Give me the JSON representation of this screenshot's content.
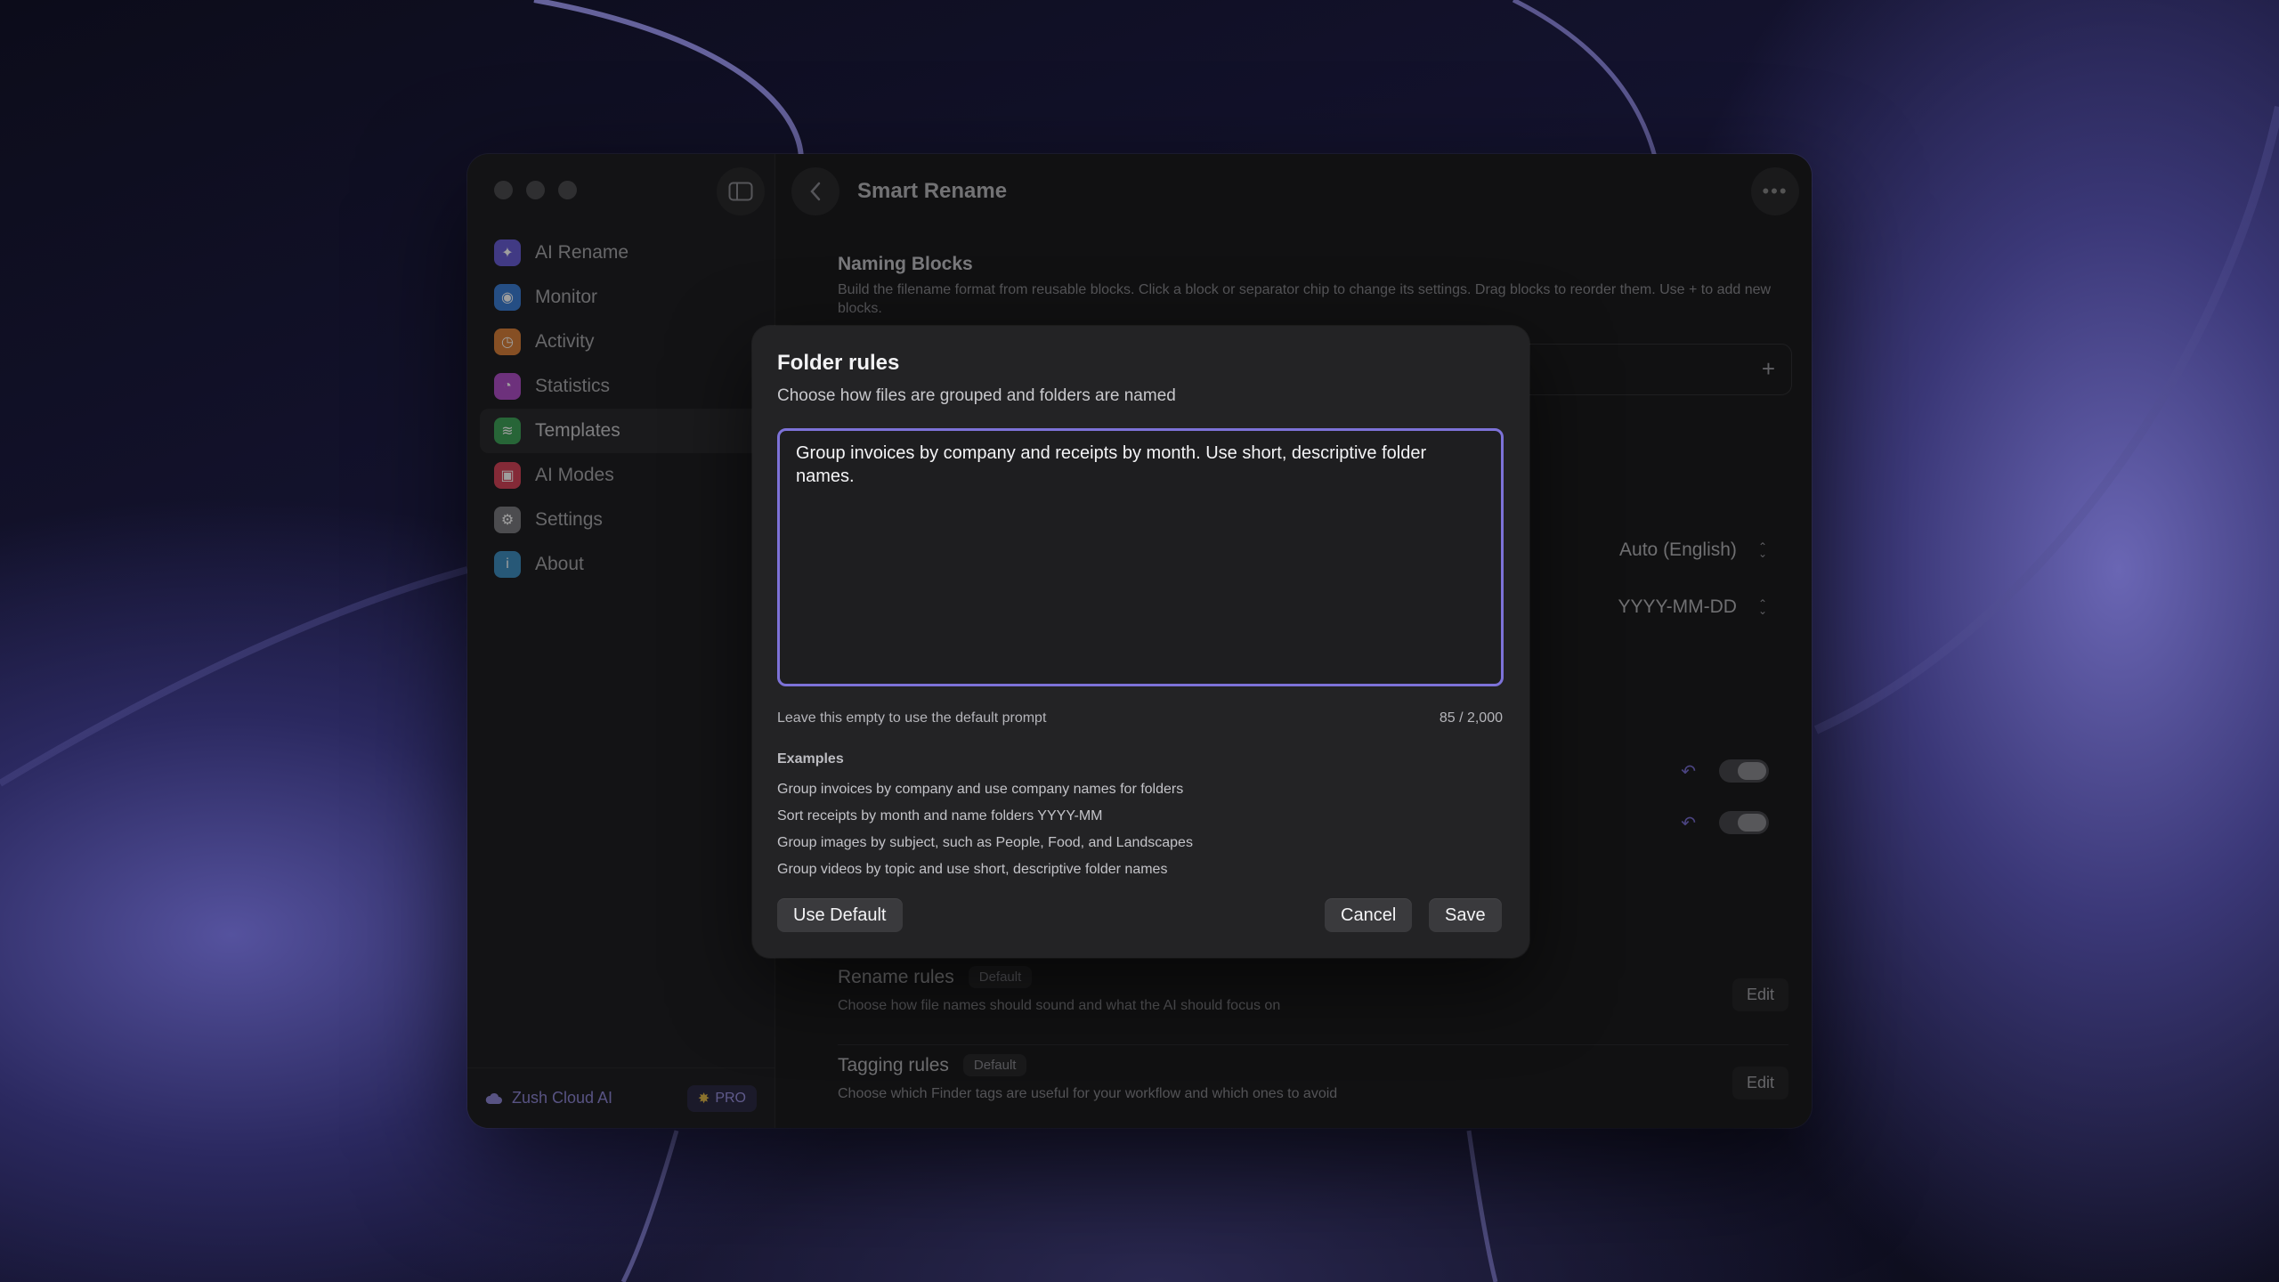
{
  "window": {
    "title": "Smart Rename"
  },
  "sidebar": {
    "items": [
      {
        "label": "AI Rename",
        "icon": "sparkles-icon",
        "color": "#6a5ed6"
      },
      {
        "label": "Monitor",
        "icon": "eye-icon",
        "color": "#3d7fd6"
      },
      {
        "label": "Activity",
        "icon": "clock-icon",
        "color": "#d9803a"
      },
      {
        "label": "Statistics",
        "icon": "pie-chart-icon",
        "color": "#b04fc8"
      },
      {
        "label": "Templates",
        "icon": "layers-icon",
        "color": "#3fa35a"
      },
      {
        "label": "AI Modes",
        "icon": "cpu-icon",
        "color": "#d6455a"
      },
      {
        "label": "Settings",
        "icon": "gear-icon",
        "color": "#7b7b80"
      },
      {
        "label": "About",
        "icon": "info-icon",
        "color": "#3f8fc0"
      }
    ],
    "footer": {
      "cloud_label": "Zush Cloud AI",
      "pro_label": "PRO"
    }
  },
  "main": {
    "naming_blocks": {
      "title": "Naming Blocks",
      "description": "Build the filename format from reusable blocks. Click a block or separator chip to change its settings. Drag blocks to reorder them. Use + to add new blocks."
    },
    "language_value": "Auto (English)",
    "date_format_value": "YYYY-MM-DD",
    "rename_rules": {
      "title": "Rename rules",
      "badge": "Default",
      "description": "Choose how file names should sound and what the AI should focus on",
      "edit": "Edit"
    },
    "tagging_rules": {
      "title": "Tagging rules",
      "badge": "Default",
      "description": "Choose which Finder tags are useful for your workflow and which ones to avoid",
      "edit": "Edit"
    }
  },
  "dialog": {
    "title": "Folder rules",
    "subtitle": "Choose how files are grouped and folders are named",
    "text": "Group invoices by company and receipts by month. Use short, descriptive folder names.",
    "hint": "Leave this empty to use the default prompt",
    "count": "85 / 2,000",
    "examples_heading": "Examples",
    "examples": [
      "Group invoices by company and use company names for folders",
      "Sort receipts by month and name folders YYYY-MM",
      "Group images by subject, such as People, Food, and Landscapes",
      "Group videos by topic and use short, descriptive folder names"
    ],
    "use_default": "Use Default",
    "cancel": "Cancel",
    "save": "Save",
    "accent": "#7d72d8"
  }
}
